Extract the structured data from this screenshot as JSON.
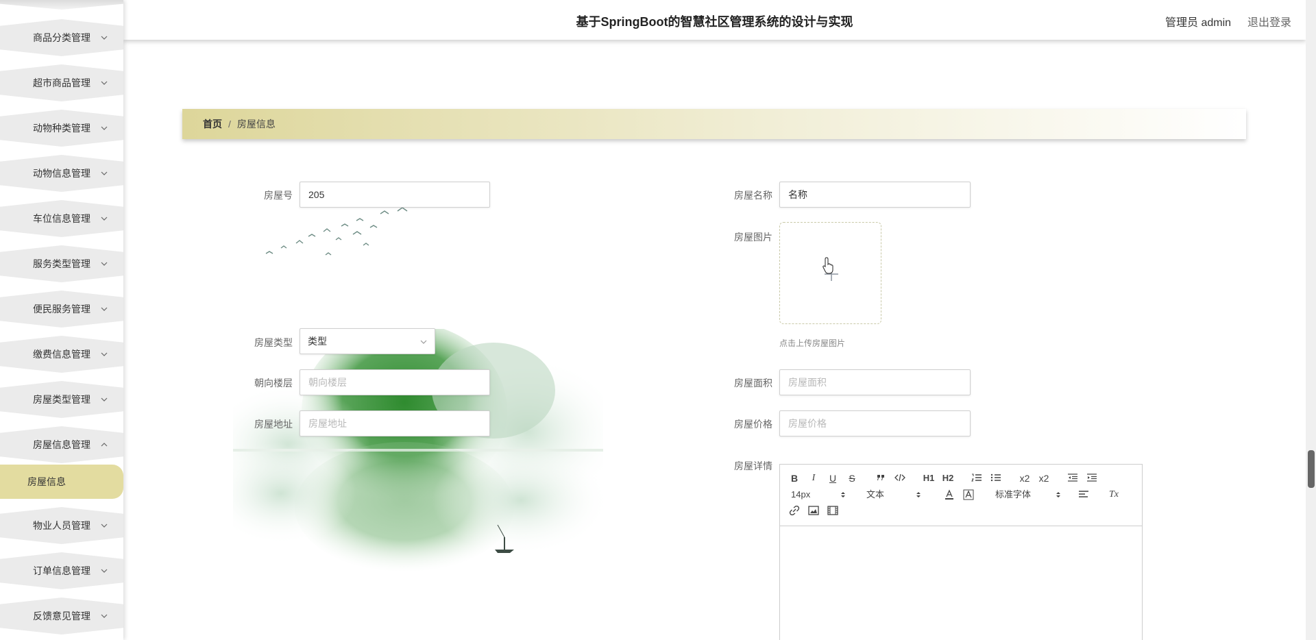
{
  "app": {
    "title": "基于SpringBoot的智慧社区管理系统的设计与实现",
    "user_label": "管理员 admin",
    "logout_label": "退出登录"
  },
  "sidebar": {
    "items": [
      {
        "label": "商品分类管理"
      },
      {
        "label": "超市商品管理"
      },
      {
        "label": "动物种类管理"
      },
      {
        "label": "动物信息管理"
      },
      {
        "label": "车位信息管理"
      },
      {
        "label": "服务类型管理"
      },
      {
        "label": "便民服务管理"
      },
      {
        "label": "缴费信息管理"
      },
      {
        "label": "房屋类型管理"
      },
      {
        "label": "房屋信息管理"
      },
      {
        "label": "物业人员管理"
      },
      {
        "label": "订单信息管理"
      },
      {
        "label": "反馈意见管理"
      }
    ],
    "active_sub": {
      "label": "房屋信息"
    }
  },
  "breadcrumb": {
    "home": "首页",
    "separator": "/",
    "current": "房屋信息"
  },
  "form": {
    "room_no": {
      "label": "房屋号",
      "value": "205"
    },
    "room_name": {
      "label": "房屋名称",
      "value": "名称"
    },
    "room_image": {
      "label": "房屋图片",
      "hint": "点击上传房屋图片"
    },
    "room_type": {
      "label": "房屋类型",
      "value": "类型"
    },
    "orientation": {
      "label": "朝向楼层",
      "placeholder": "朝向楼层"
    },
    "area": {
      "label": "房屋面积",
      "placeholder": "房屋面积"
    },
    "address": {
      "label": "房屋地址",
      "placeholder": "房屋地址"
    },
    "price": {
      "label": "房屋价格",
      "placeholder": "房屋价格"
    },
    "detail": {
      "label": "房屋详情"
    }
  },
  "editor": {
    "font_size": "14px",
    "block_format": "文本",
    "font_family": "标准字体",
    "buttons": {
      "bold": "B",
      "italic": "I",
      "underline": "U",
      "strike": "S",
      "h1": "H1",
      "h2": "H2",
      "sub": "x2",
      "sup": "x2",
      "clean": "Tx"
    }
  }
}
